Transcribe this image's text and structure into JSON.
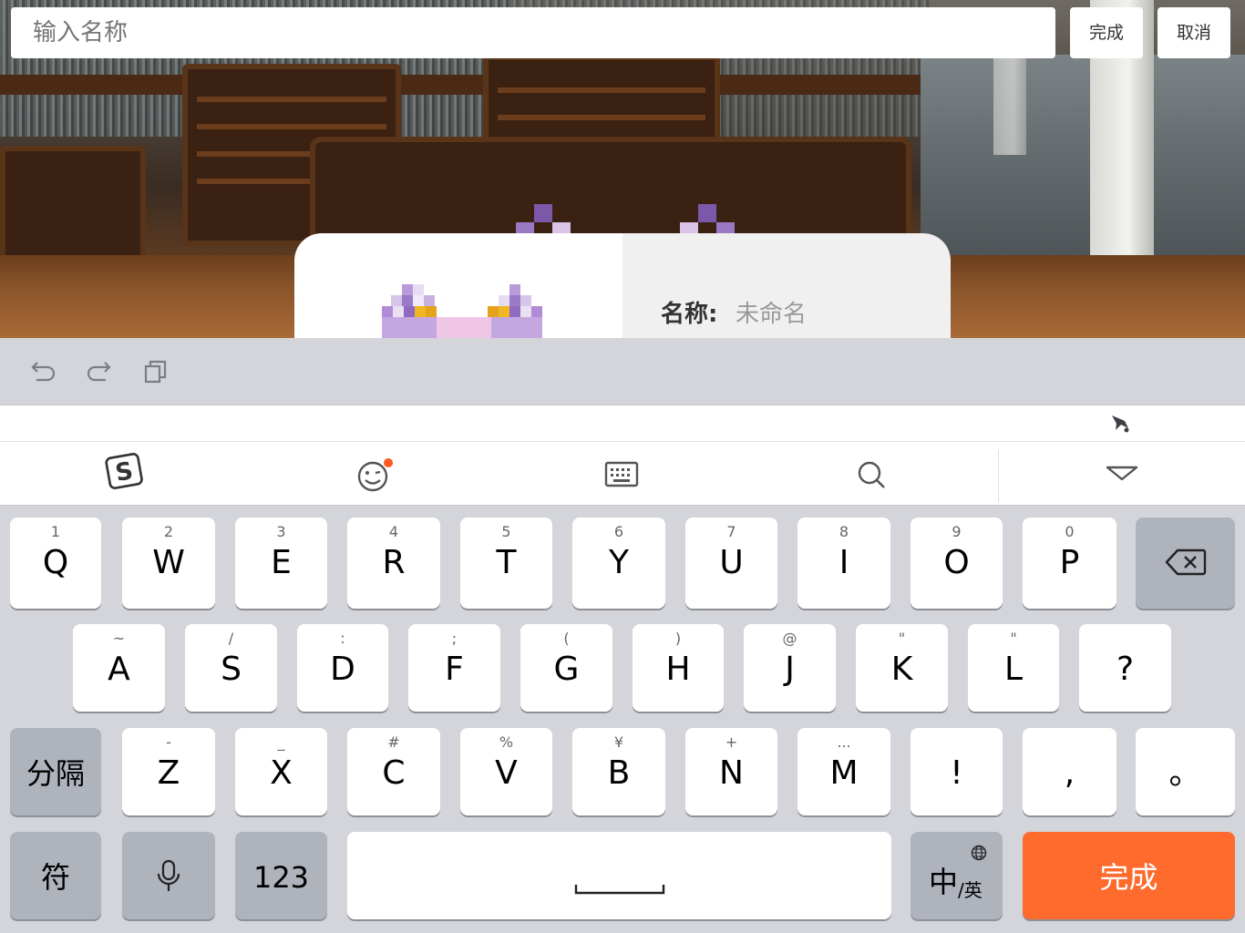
{
  "top_bar": {
    "input_placeholder": "输入名称",
    "done_label": "完成",
    "cancel_label": "取消"
  },
  "card": {
    "name_label": "名称:",
    "name_value": "未命名"
  },
  "toolbar": {
    "icons": [
      "undo-icon",
      "redo-icon",
      "copy-icon"
    ]
  },
  "ime_bar": {
    "icons": [
      "sogou-logo-icon",
      "emoji-icon",
      "keyboard-icon",
      "search-icon",
      "collapse-icon"
    ],
    "rocket_icon": "rocket-icon",
    "notification_dot_color": "#ff5a1f"
  },
  "keyboard": {
    "row1": [
      {
        "sub": "1",
        "main": "Q"
      },
      {
        "sub": "2",
        "main": "W"
      },
      {
        "sub": "3",
        "main": "E"
      },
      {
        "sub": "4",
        "main": "R"
      },
      {
        "sub": "5",
        "main": "T"
      },
      {
        "sub": "6",
        "main": "Y"
      },
      {
        "sub": "7",
        "main": "U"
      },
      {
        "sub": "8",
        "main": "I"
      },
      {
        "sub": "9",
        "main": "O"
      },
      {
        "sub": "0",
        "main": "P"
      }
    ],
    "row2": [
      {
        "sub": "~",
        "main": "A"
      },
      {
        "sub": "/",
        "main": "S"
      },
      {
        "sub": ":",
        "main": "D"
      },
      {
        "sub": ";",
        "main": "F"
      },
      {
        "sub": "(",
        "main": "G"
      },
      {
        "sub": ")",
        "main": "H"
      },
      {
        "sub": "@",
        "main": "J"
      },
      {
        "sub": "\"",
        "main": "K"
      },
      {
        "sub": "\"",
        "main": "L"
      },
      {
        "sub": "",
        "main": "?"
      }
    ],
    "row3": [
      {
        "sub": "-",
        "main": "Z"
      },
      {
        "sub": "_",
        "main": "X"
      },
      {
        "sub": "#",
        "main": "C"
      },
      {
        "sub": "%",
        "main": "V"
      },
      {
        "sub": "¥",
        "main": "B"
      },
      {
        "sub": "+",
        "main": "N"
      },
      {
        "sub": "...",
        "main": "M"
      },
      {
        "sub": "",
        "main": "!"
      },
      {
        "sub": "",
        "main": ","
      },
      {
        "sub": "",
        "main": "。"
      }
    ],
    "separator_label": "分隔",
    "symbol_label": "符",
    "numbers_label": "123",
    "lang_main": "中",
    "lang_sub": "/英",
    "space_symbol": "␣",
    "done_label": "完成",
    "accent_color": "#ff6a2d"
  }
}
